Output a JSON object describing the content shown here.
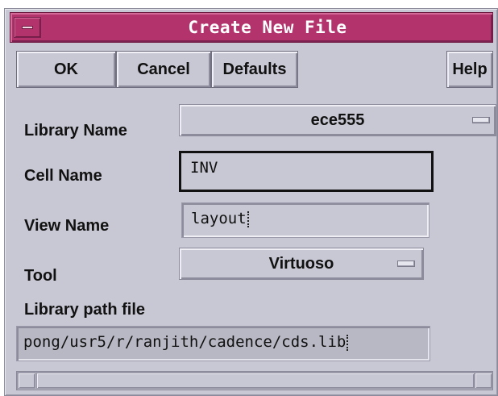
{
  "window": {
    "title": "Create New File"
  },
  "buttons": {
    "ok": "OK",
    "cancel": "Cancel",
    "defaults": "Defaults",
    "help": "Help"
  },
  "form": {
    "library_name": {
      "label": "Library Name",
      "value": "ece555"
    },
    "cell_name": {
      "label": "Cell Name",
      "value": "INV"
    },
    "view_name": {
      "label": "View Name",
      "value": "layout"
    },
    "tool": {
      "label": "Tool",
      "value": "Virtuoso"
    },
    "library_path": {
      "label": "Library path file",
      "value": "pong/usr5/r/ranjith/cadence/cds.lib"
    }
  },
  "icons": {
    "window_menu": "window-menu-icon",
    "option_indicator": "option-menu-indicator-icon",
    "scroll_left": "scroll-left-arrow-icon",
    "scroll_right": "scroll-right-arrow-icon"
  },
  "colors": {
    "titlebar": "#b3346d",
    "window_bg": "#c8c8d4",
    "title_text": "#ffffff"
  }
}
